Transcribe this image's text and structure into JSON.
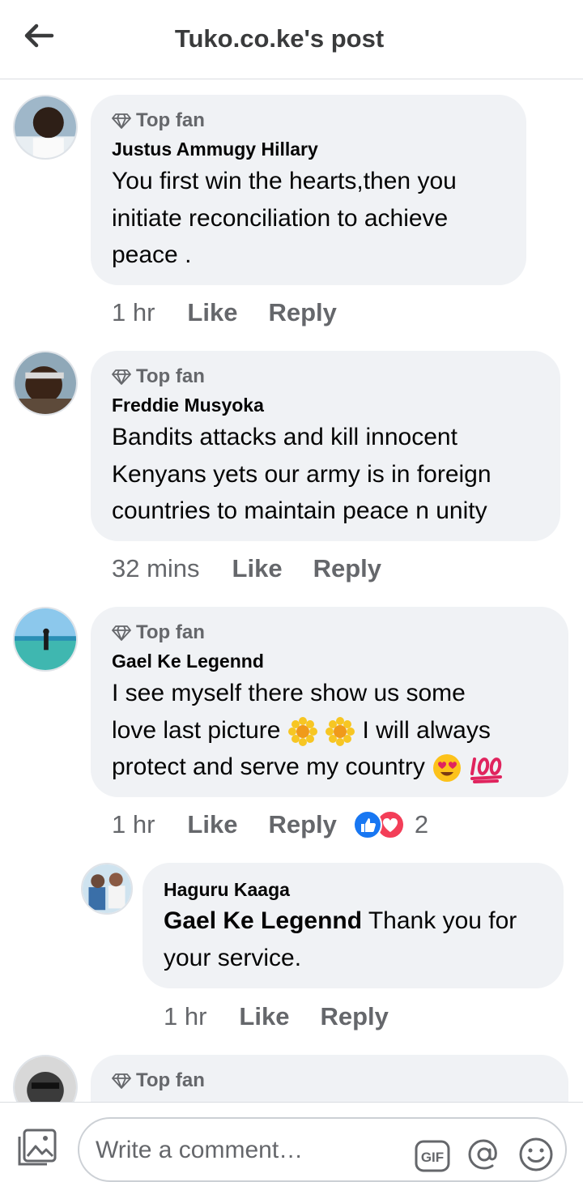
{
  "header": {
    "title": "Tuko.co.ke's post",
    "back_icon": "arrow-left-icon"
  },
  "comments": [
    {
      "badge": "Top fan",
      "author": "Justus Ammugy Hillary",
      "lines": [
        "You first win the hearts,then you",
        "initiate reconciliation to achieve",
        "peace ."
      ],
      "time": "1 hr",
      "like": "Like",
      "reply": "Reply"
    },
    {
      "badge": "Top fan",
      "author": "Freddie Musyoka",
      "lines": [
        "Bandits attacks and kill innocent",
        "Kenyans yets our army is in foreign",
        "countries to maintain peace n unity"
      ],
      "time": "32 mins",
      "like": "Like",
      "reply": "Reply"
    },
    {
      "badge": "Top fan",
      "author": "Gael Ke Legennd",
      "lines": [
        "I see myself there show us some",
        "love  last picture",
        " I will always",
        "protect and serve my country "
      ],
      "time": "1 hr",
      "like": "Like",
      "reply": "Reply",
      "reaction_count": "2"
    },
    {
      "badge": "Top fan"
    }
  ],
  "reply": {
    "author": "Haguru Kaaga",
    "mention": "Gael Ke Legennd",
    "text_1": " Thank you for",
    "text_2": "your service.",
    "time": "1 hr",
    "like": "Like",
    "reply": "Reply"
  },
  "composer": {
    "placeholder": "Write a comment…",
    "gif_label": "GIF",
    "icons": [
      "photo-icon",
      "gif-icon",
      "at-sign-icon",
      "smiley-icon"
    ]
  },
  "colors": {
    "bubble": "#f0f2f5",
    "meta": "#65676b",
    "like_blue": "#1877f2",
    "love_red": "#f33e58"
  }
}
